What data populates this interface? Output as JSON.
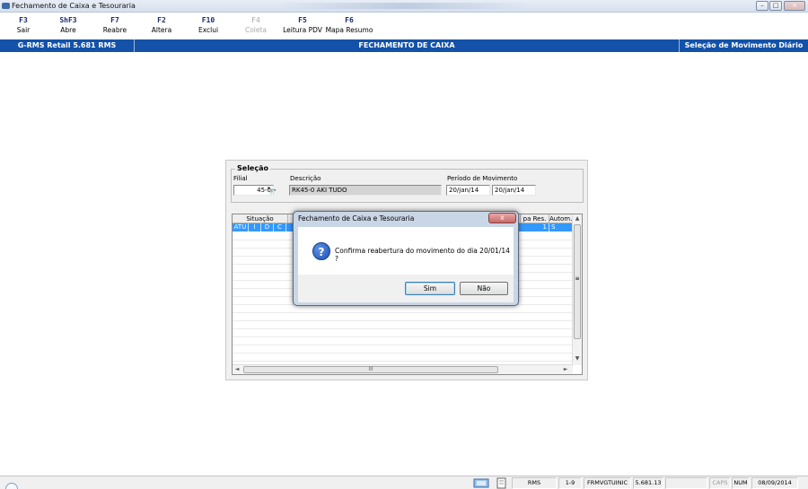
{
  "window": {
    "title": "Fechamento de Caixa e Tesouraria",
    "controls": {
      "minimize": "–",
      "maximize": "□",
      "close": "×"
    }
  },
  "toolbar": [
    {
      "key": "F3",
      "label": "Sair",
      "enabled": true
    },
    {
      "key": "ShF3",
      "label": "Abre",
      "enabled": true
    },
    {
      "key": "F7",
      "label": "Reabre",
      "enabled": true
    },
    {
      "key": "F2",
      "label": "Altera",
      "enabled": true
    },
    {
      "key": "F10",
      "label": "Exclui",
      "enabled": true
    },
    {
      "key": "F4",
      "label": "Coleta",
      "enabled": false
    },
    {
      "key": "F5",
      "label": "Leitura PDV",
      "enabled": true
    },
    {
      "key": "F6",
      "label": "Mapa Resumo",
      "enabled": true
    }
  ],
  "header": {
    "app_version": "G-RMS Retail 5.681 RMS",
    "screen_title": "FECHAMENTO DE CAIXA",
    "subtitle": "Seleção de Movimento Diário",
    "color": "#1352a8"
  },
  "selecao": {
    "group_title": "Seleção",
    "filial_label": "Filial",
    "filial_value": "45-0",
    "descricao_label": "Descrição",
    "descricao_value": "RK45-0 AKI TUDO",
    "periodo_label": "Período de Movimento",
    "periodo_de": "20/jan/14",
    "periodo_ate": "20/jan/14",
    "search_icon": "binoculars-icon"
  },
  "grid": {
    "headers": {
      "situacao": "Situação",
      "mapa_res": "pa Res.",
      "autom": "Autom."
    },
    "row": {
      "c1": "ATU",
      "c2": "I",
      "c3": "D",
      "c4": "C",
      "mapa": "1",
      "autom": "S"
    },
    "selected_color": "#3399ff",
    "scroll": {
      "up": "▲",
      "down": "▼",
      "left": "◄",
      "right": "►",
      "grip_h": "III",
      "grip_v": "≡"
    }
  },
  "dialog": {
    "title": "Fechamento de Caixa e Tesouraria",
    "close": "x",
    "icon": "question-icon",
    "icon_glyph": "?",
    "message": "Confirma reabertura do movimento do dia 20/01/14 ?",
    "yes": "Sim",
    "no": "Não"
  },
  "status": {
    "server": "RMS",
    "range": "1-9",
    "program": "FRMVGTUINIC",
    "version": "5.681.13",
    "caps": "CAPS",
    "num": "NUM",
    "date": "08/09/2014"
  }
}
